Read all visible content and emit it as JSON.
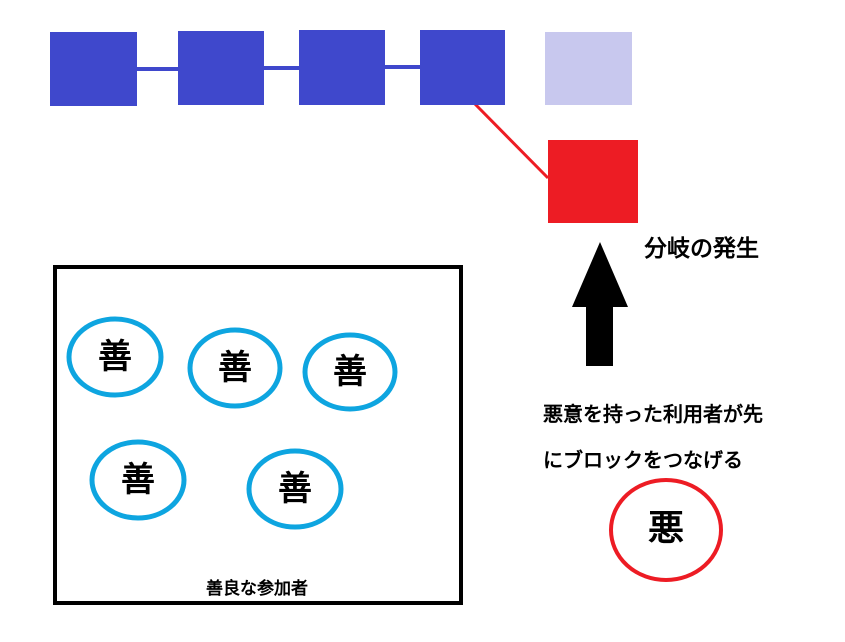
{
  "colors": {
    "chain_block": "#3f48cc",
    "pending_block": "#c8c8ee",
    "fork_block": "#ed1c24",
    "fork_link": "#ed1c24",
    "good_circle": "#0ea5e0",
    "bad_circle": "#ed1c24",
    "arrow": "#000000"
  },
  "fork_label": "分岐の発生",
  "malicious_desc_line1": "悪意を持った利用者が先",
  "malicious_desc_line2": "にブロックをつなげる",
  "bad_actor_glyph": "悪",
  "good_group": {
    "caption": "善良な参加者",
    "members": [
      {
        "glyph": "善"
      },
      {
        "glyph": "善"
      },
      {
        "glyph": "善"
      },
      {
        "glyph": "善"
      },
      {
        "glyph": "善"
      }
    ]
  }
}
